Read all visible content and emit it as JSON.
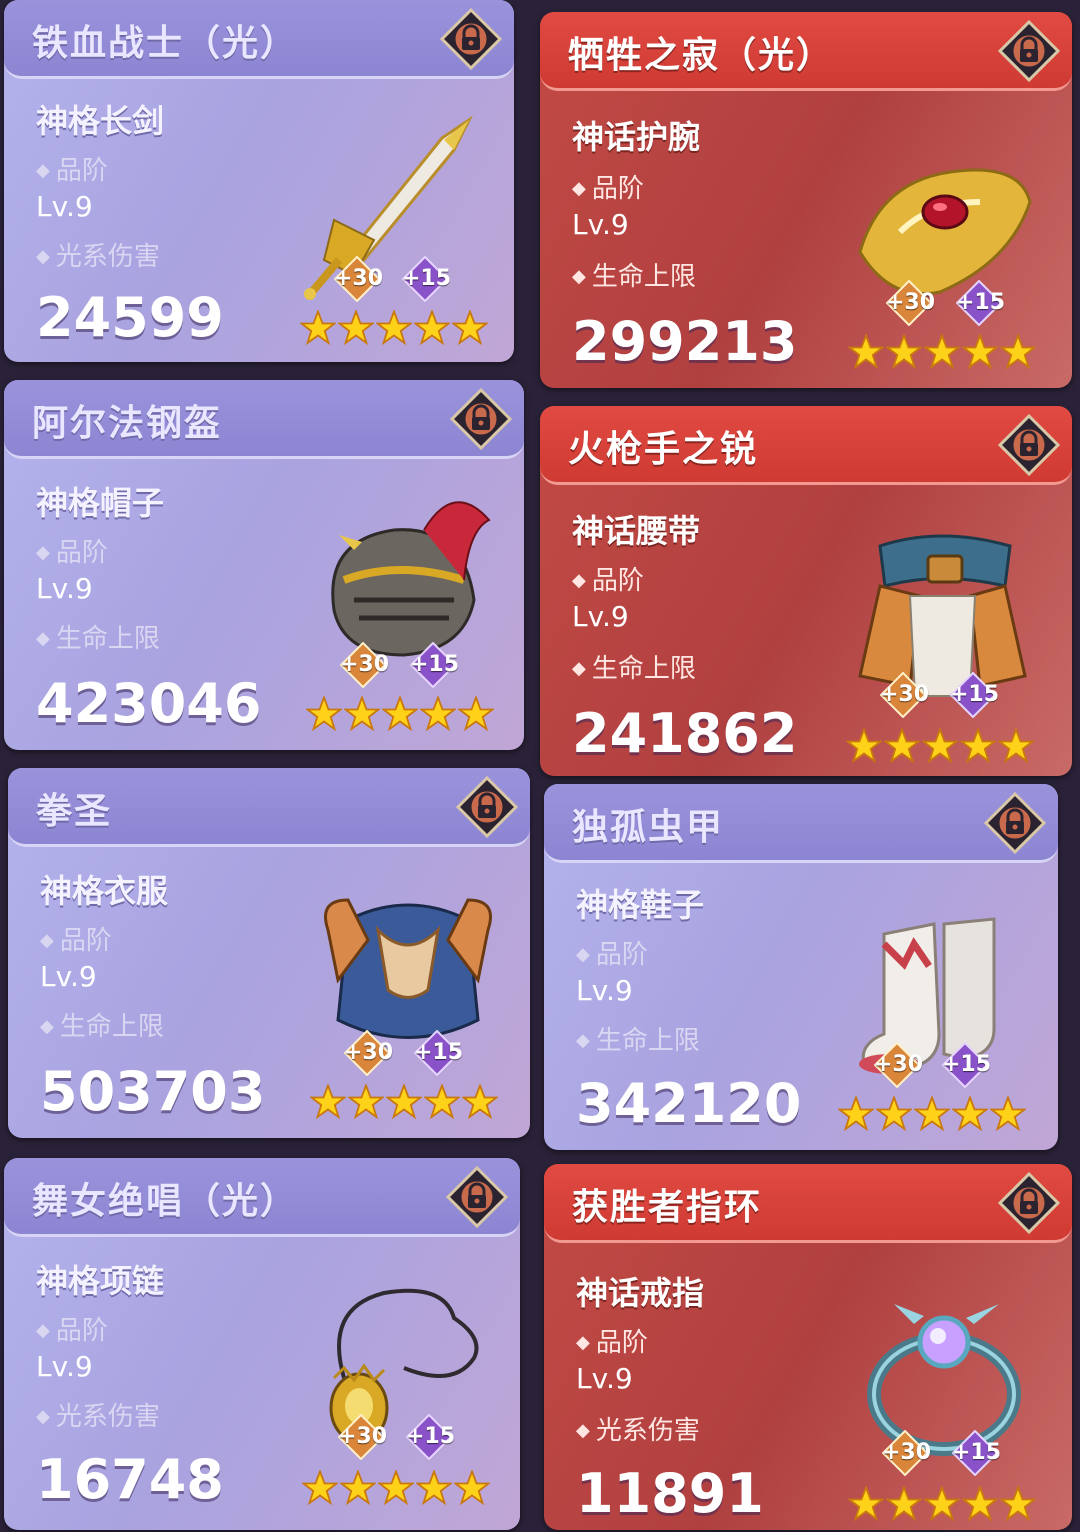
{
  "cards": [
    {
      "title": "铁血战士（光）",
      "item": "神格长剑",
      "grade": "品阶",
      "level": "Lv.9",
      "stat": "光系伤害",
      "value": "24599",
      "badge1": "+30",
      "badge2": "+15",
      "theme": "purple",
      "icon": "sword-icon"
    },
    {
      "title": "牺牲之寂（光）",
      "item": "神话护腕",
      "grade": "品阶",
      "level": "Lv.9",
      "stat": "生命上限",
      "value": "299213",
      "badge1": "+30",
      "badge2": "+15",
      "theme": "red",
      "icon": "bracer-icon"
    },
    {
      "title": "阿尔法钢盔",
      "item": "神格帽子",
      "grade": "品阶",
      "level": "Lv.9",
      "stat": "生命上限",
      "value": "423046",
      "badge1": "+30",
      "badge2": "+15",
      "theme": "purple",
      "icon": "helmet-icon"
    },
    {
      "title": "火枪手之锐",
      "item": "神话腰带",
      "grade": "品阶",
      "level": "Lv.9",
      "stat": "生命上限",
      "value": "241862",
      "badge1": "+30",
      "badge2": "+15",
      "theme": "red",
      "icon": "belt-icon"
    },
    {
      "title": "拳圣",
      "item": "神格衣服",
      "grade": "品阶",
      "level": "Lv.9",
      "stat": "生命上限",
      "value": "503703",
      "badge1": "+30",
      "badge2": "+15",
      "theme": "purple",
      "icon": "armor-icon"
    },
    {
      "title": "独孤虫甲",
      "item": "神格鞋子",
      "grade": "品阶",
      "level": "Lv.9",
      "stat": "生命上限",
      "value": "342120",
      "badge1": "+30",
      "badge2": "+15",
      "theme": "purple",
      "icon": "boots-icon"
    },
    {
      "title": "舞女绝唱（光）",
      "item": "神格项链",
      "grade": "品阶",
      "level": "Lv.9",
      "stat": "光系伤害",
      "value": "16748",
      "badge1": "+30",
      "badge2": "+15",
      "theme": "purple",
      "icon": "necklace-icon"
    },
    {
      "title": "获胜者指环",
      "item": "神话戒指",
      "grade": "品阶",
      "level": "Lv.9",
      "stat": "光系伤害",
      "value": "11891",
      "badge1": "+30",
      "badge2": "+15",
      "theme": "red",
      "icon": "ring-icon"
    }
  ],
  "stars_per_card": 5,
  "colors": {
    "purple": "#a9a3e0",
    "red": "#b04040",
    "star": "#ffd21a",
    "badge_orange": "#d9853a",
    "badge_purple": "#8a52c8"
  }
}
